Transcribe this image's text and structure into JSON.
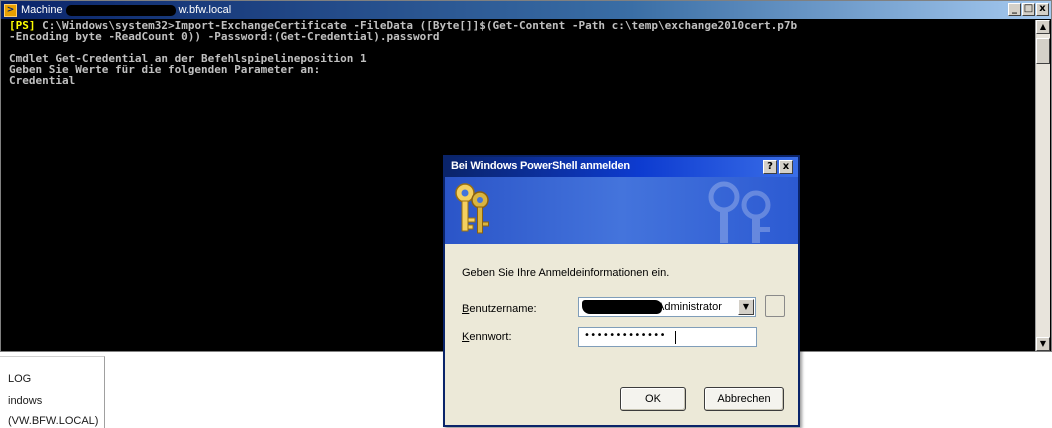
{
  "console": {
    "title_prefix": "Machine",
    "title_suffix": "w.bfw.local",
    "window_buttons": {
      "minimize": "_",
      "maximize": "□",
      "close": "x"
    },
    "prompt": "[PS]",
    "command_line_1": " C:\\Windows\\system32>Import-ExchangeCertificate -FileData ([Byte[]]$(Get-Content -Path c:\\temp\\exchange2010cert.p7b",
    "command_line_2": "-Encoding byte -ReadCount 0)) -Password:(Get-Credential).password",
    "output_line_1": "Cmdlet Get-Credential an der Befehlspipelineposition 1",
    "output_line_2": "Geben Sie Werte für die folgenden Parameter an:",
    "output_line_3": "Credential",
    "colors": {
      "background": "#000000",
      "text": "#c0c0c0",
      "prompt": "#ffff00"
    }
  },
  "tree": {
    "items": [
      "LOG",
      "indows",
      "(VW.BFW.LOCAL)"
    ]
  },
  "dialog": {
    "title": "Bei Windows PowerShell anmelden",
    "help_button": "?",
    "close_button": "x",
    "prompt": "Geben Sie Ihre Anmeldeinformationen ein.",
    "username_label_access": "B",
    "username_label_rest": "enutzername:",
    "username_value": "\\Administrator",
    "password_label_access": "K",
    "password_label_rest": "ennwort:",
    "password_value": "•••••••••••••",
    "ok_label": "OK",
    "cancel_label": "Abbrechen",
    "colors": {
      "title_bar": "#0a246a",
      "banner": "#2b55c8",
      "body": "#ece9d8"
    }
  }
}
